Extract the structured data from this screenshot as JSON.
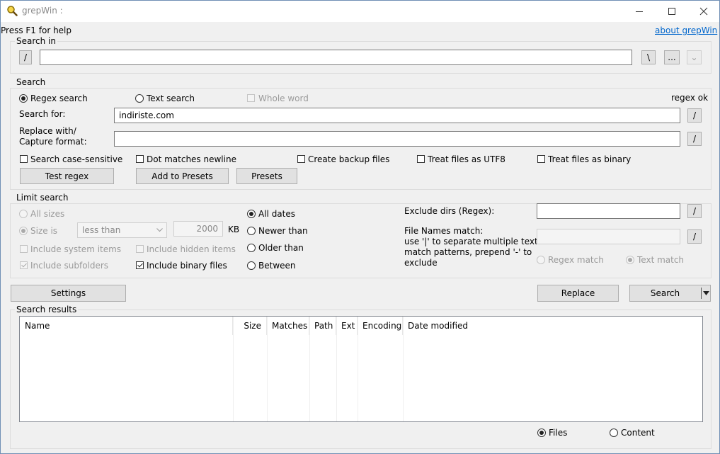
{
  "window": {
    "title": "grepWin :"
  },
  "help_text": "Press F1 for help",
  "about_link": "about grepWin",
  "search_in": {
    "label": "Search in",
    "slash_btn": "/",
    "path_value": "",
    "backslash_btn": "\\",
    "browse_btn": "...",
    "history_btn": "⌄"
  },
  "search": {
    "label": "Search",
    "regex_label": "Regex search",
    "text_label": "Text search",
    "whole_word_label": "Whole word",
    "status": "regex ok",
    "search_for_label": "Search for:",
    "search_for_value": "indiriste.com",
    "replace_label_1": "Replace with/",
    "replace_label_2": "Capture format:",
    "replace_value": "",
    "slash_btn": "/",
    "case_sensitive_label": "Search case-sensitive",
    "dot_newline_label": "Dot matches newline",
    "backup_label": "Create backup files",
    "utf8_label": "Treat files as UTF8",
    "binary_label": "Treat files as binary",
    "test_regex_btn": "Test regex",
    "add_presets_btn": "Add to Presets",
    "presets_btn": "Presets"
  },
  "limit": {
    "label": "Limit search",
    "all_sizes_label": "All sizes",
    "size_is_label": "Size is",
    "size_cmp_value": "less than",
    "size_value": "2000",
    "size_unit": "KB",
    "all_dates_label": "All dates",
    "newer_label": "Newer than",
    "older_label": "Older than",
    "between_label": "Between",
    "system_items_label": "Include system items",
    "hidden_items_label": "Include hidden items",
    "subfolders_label": "Include subfolders",
    "binary_files_label": "Include binary files",
    "exclude_dirs_label": "Exclude dirs (Regex):",
    "exclude_dirs_value": "",
    "file_names_label_1": "File Names match:",
    "file_names_label_2": "use '|' to separate multiple text",
    "file_names_label_3": "match patterns, prepend '-' to",
    "file_names_label_4": "exclude",
    "file_names_value": "",
    "regex_match_label": "Regex match",
    "text_match_label": "Text match",
    "slash_btn": "/"
  },
  "actions": {
    "settings_btn": "Settings",
    "replace_btn": "Replace",
    "search_btn": "Search"
  },
  "results": {
    "label": "Search results",
    "columns": [
      "Name",
      "Size",
      "Matches",
      "Path",
      "Ext",
      "Encoding",
      "Date modified"
    ],
    "files_label": "Files",
    "content_label": "Content"
  },
  "icons": {
    "app": "magnifier-icon",
    "dropdown": "chevron-down-icon"
  },
  "colors": {
    "link": "#0066cc",
    "border": "#adadad",
    "bg": "#f0f0f0"
  }
}
